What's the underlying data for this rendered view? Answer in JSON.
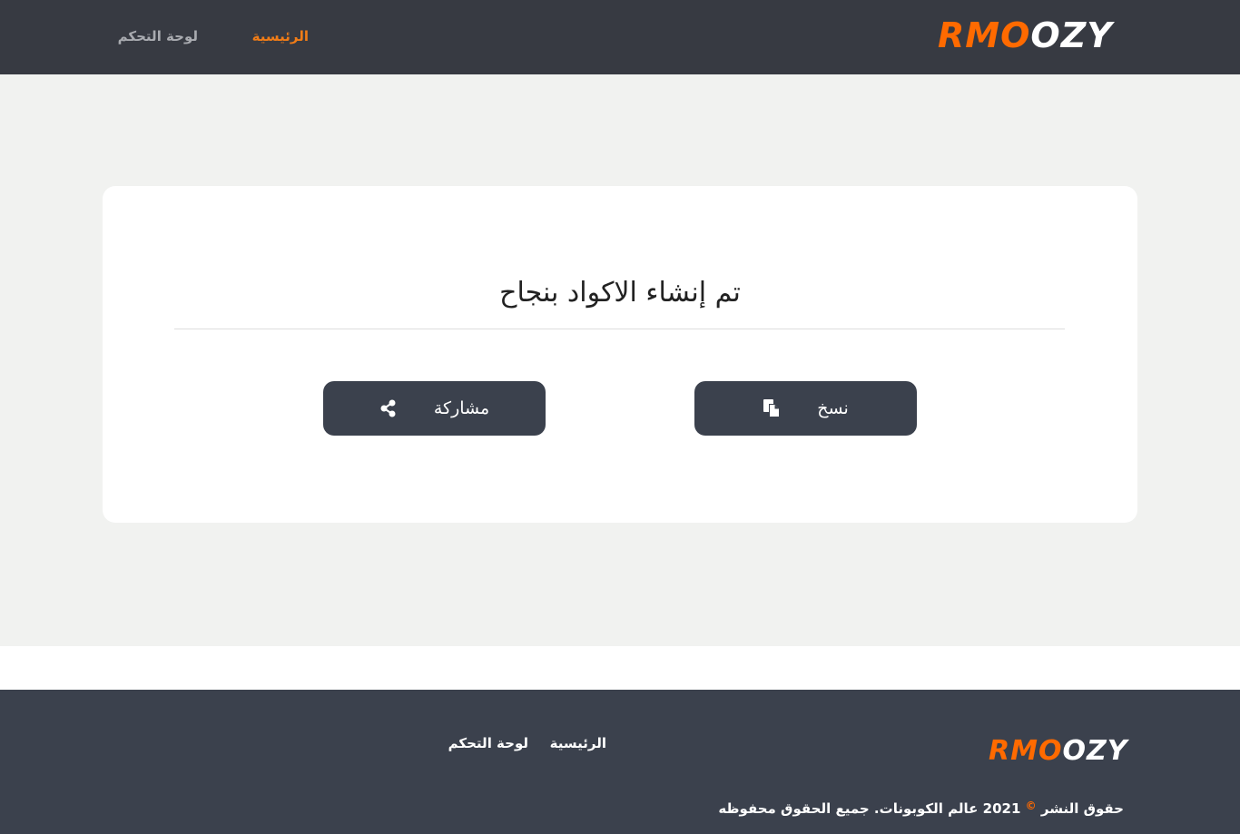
{
  "header": {
    "logo_part1": "RMO",
    "logo_part2": "OZY",
    "nav": {
      "home": "الرئيسية",
      "dashboard": "لوحة التحكم"
    }
  },
  "card": {
    "title": "تم إنشاء الاكواد بنجاح",
    "copy_button": "نسخ",
    "share_button": "مشاركة"
  },
  "footer": {
    "logo_part1": "RMO",
    "logo_part2": "OZY",
    "nav": {
      "home": "الرئيسية",
      "dashboard": "لوحة التحكم"
    },
    "copyright_prefix": "حقوق النشر",
    "copyright_symbol": "©",
    "copyright_rest": "2021 عالم الكوبونات. جميع الحقوق محفوظه"
  },
  "colors": {
    "header_bg": "#373a42",
    "footer_bg": "#3b414d",
    "accent": "#ff6a00",
    "button_bg": "#3b414d",
    "page_bg": "#f1f2f0"
  },
  "icons": {
    "copy": "copy-icon",
    "share": "share-icon"
  }
}
